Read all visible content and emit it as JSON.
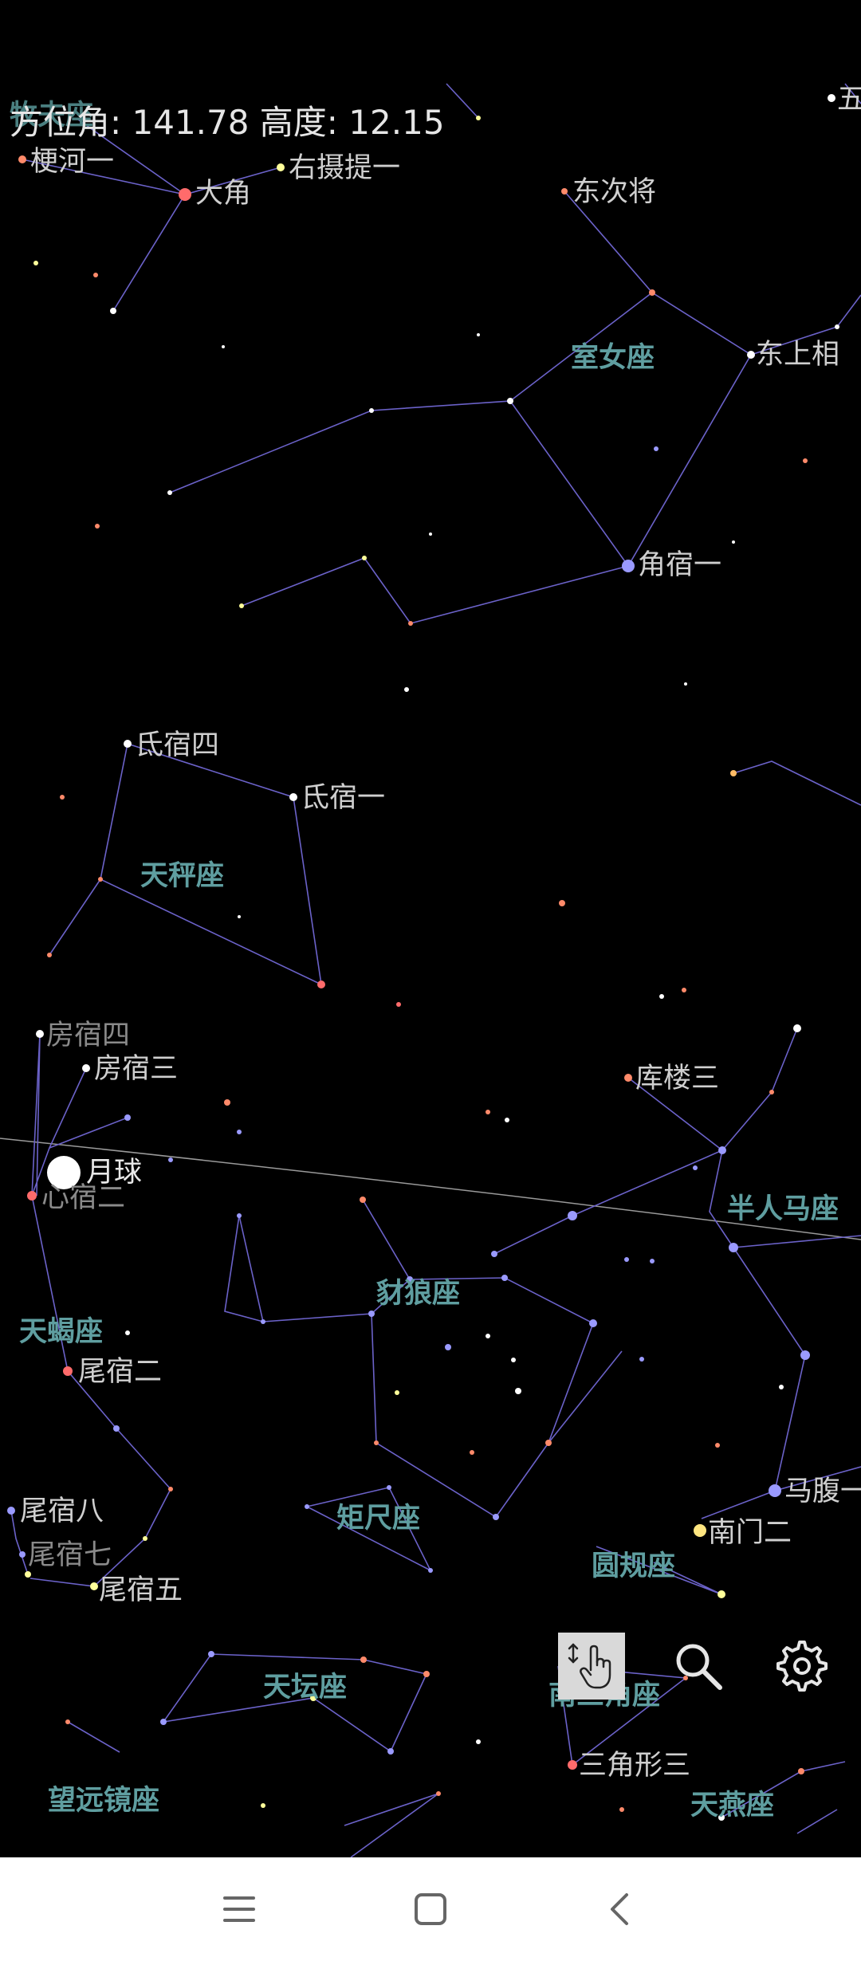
{
  "readout": {
    "text": "方位角: 141.78 高度: 12.15"
  },
  "sky": {
    "stars": {
      "fang_su_si": "房宿四",
      "fang_su_san": "房宿三",
      "xin_su_er": "心宿二",
      "wei_su_er": "尾宿二",
      "wei_su_ba": "尾宿八",
      "wei_su_qi": "尾宿七",
      "wei_su_wu": "尾宿五",
      "di_su_si": "氐宿四",
      "di_su_yi": "氐宿一",
      "jiao_su_yi": "角宿一",
      "dong_ci_jiang": "东次将",
      "dong_shang_xiang": "东上相",
      "da_jiao": "大角",
      "you_she_ti_yi": "右摄提一",
      "geng_he_yi": "梗河一",
      "ku_lou_san": "库楼三",
      "ma_fu_yi": "马腹一",
      "nan_men_er": "南门二",
      "san_jiao_xing_san": "三角形三",
      "wu_partial": "五"
    },
    "constellations": {
      "virgo": "室女座",
      "libra": "天秤座",
      "scorpius": "天蝎座",
      "lupus": "豺狼座",
      "centaurus": "半人马座",
      "norma": "矩尺座",
      "circinus": "圆规座",
      "ara": "天坛座",
      "triangulum_australe": "南三角座",
      "telescopium": "望远镜座",
      "apus": "天燕座",
      "bootes_partial": "牧夫座"
    },
    "moon_label": "月球"
  },
  "toolbar": {
    "touch_icon": "touch-hand-icon",
    "search_icon": "search-icon",
    "settings_icon": "gear-icon"
  },
  "navbar": {
    "menu_icon": "menu-icon",
    "home_icon": "home-icon",
    "back_icon": "back-icon"
  },
  "colors": {
    "background": "#000000",
    "constellation_line": "#6b62c9",
    "star_label": "#cfcfcf",
    "constellation_label": "#5f9ea0",
    "navbar": "#ffffff"
  }
}
